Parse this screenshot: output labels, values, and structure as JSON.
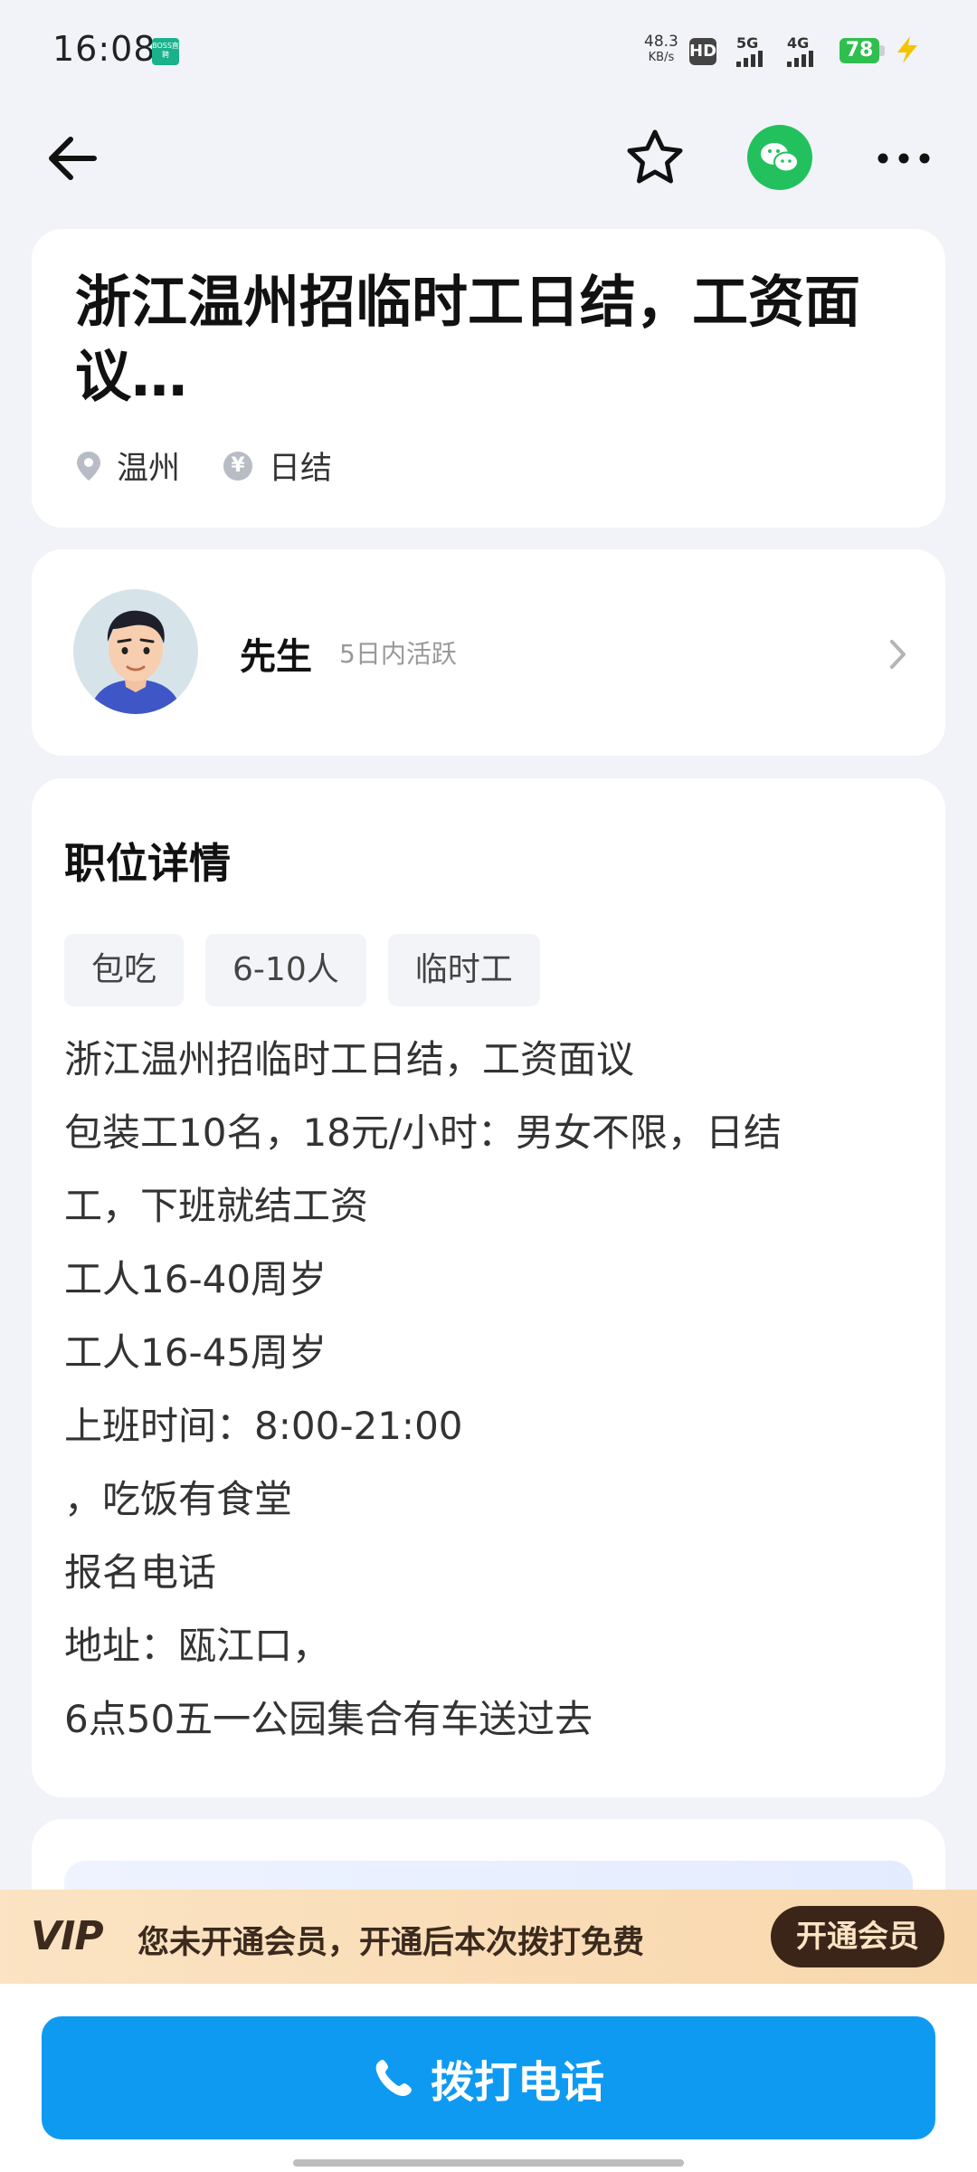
{
  "status_bar": {
    "time": "16:08",
    "app_badge": "BOSS直聘",
    "net_speed_value": "48.3",
    "net_speed_unit": "KB/s",
    "hd_label": "HD",
    "network_1": "5G",
    "network_2": "4G",
    "battery": "78"
  },
  "nav": {
    "back_icon": "arrow-left-icon",
    "favorite_icon": "star-outline-icon",
    "share_icon": "wechat-icon",
    "more_icon": "more-horizontal-icon"
  },
  "job": {
    "title": "浙江温州招临时工日结，工资面议…",
    "location": "温州",
    "pay_type": "日结"
  },
  "poster": {
    "name": "先生",
    "activity": "5日内活跃"
  },
  "details": {
    "section_title": "职位详情",
    "tags": [
      "包吃",
      "6-10人",
      "临时工"
    ],
    "description_lines": [
      "浙江温州招临时工日结，工资面议",
      "包装工10名，18元/小时：男女不限，日结",
      "工，下班就结工资",
      "工人16-40周岁",
      "工人16-45周岁",
      "上班时间：8:00-21:00",
      "，吃饭有食堂",
      "报名电话",
      "地址：瓯江口，",
      "6点50五一公园集合有车送过去"
    ]
  },
  "vip_banner": {
    "logo": "VIP",
    "message": "您未开通会员，开通后本次拨打免费",
    "button": "开通会员"
  },
  "call_button": {
    "label": "拨打电话"
  },
  "colors": {
    "primary": "#0f9af2",
    "wechat": "#22c15e",
    "page_bg": "#f2f3f8",
    "vip_dark": "#3b2418"
  }
}
